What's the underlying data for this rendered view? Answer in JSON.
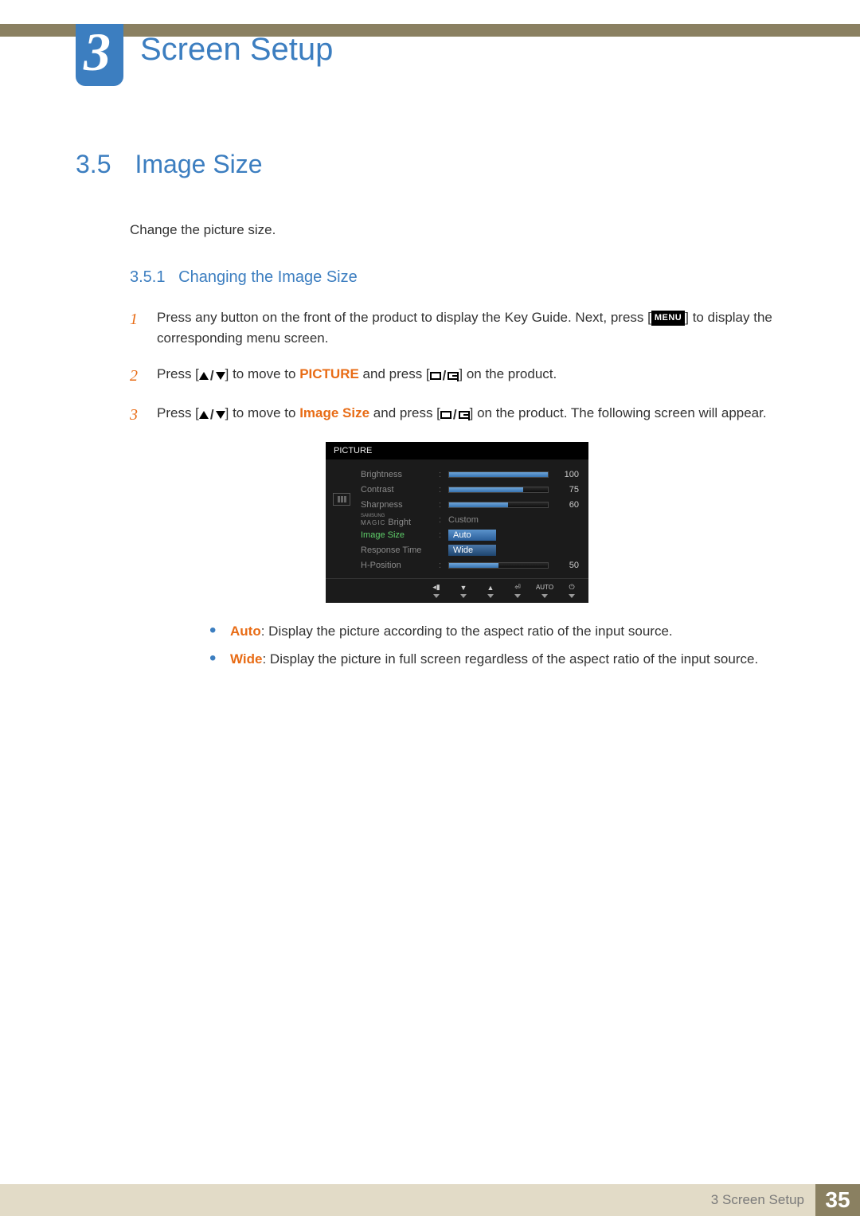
{
  "chapter": {
    "number": "3",
    "title": "Screen Setup"
  },
  "section": {
    "number": "3.5",
    "title": "Image Size",
    "intro": "Change the picture size."
  },
  "subsection": {
    "number": "3.5.1",
    "title": "Changing the Image Size"
  },
  "steps": {
    "s1": {
      "n": "1",
      "pre": "Press any button on the front of the product to display the Key Guide. Next, press [",
      "menu": "MENU",
      "post": "] to display the corresponding menu screen."
    },
    "s2": {
      "n": "2",
      "pre": "Press [",
      "mid": "] to move to ",
      "hl": "PICTURE",
      "mid2": " and press [",
      "post": "] on the product."
    },
    "s3": {
      "n": "3",
      "pre": "Press [",
      "mid": "] to move to ",
      "hl": "Image Size",
      "mid2": " and press [",
      "post": "] on the product. The following screen will appear."
    }
  },
  "osd": {
    "title": "PICTURE",
    "rows": {
      "brightness": {
        "label": "Brightness",
        "value": "100",
        "fill": 100
      },
      "contrast": {
        "label": "Contrast",
        "value": "75",
        "fill": 75
      },
      "sharpness": {
        "label": "Sharpness",
        "value": "60",
        "fill": 60
      },
      "magic": {
        "labelBrand": "SAMSUNG",
        "labelMagic": "MAGIC",
        "labelSuffix": " Bright",
        "text": "Custom"
      },
      "imagesize": {
        "label": "Image Size",
        "opt1": "Auto",
        "opt2": "Wide"
      },
      "response": {
        "label": "Response Time"
      },
      "hpos": {
        "label": "H-Position",
        "value": "50",
        "fill": 50
      }
    },
    "footer": {
      "auto": "AUTO"
    }
  },
  "bullets": {
    "b1": {
      "term": "Auto",
      "desc": ": Display the picture according to the aspect ratio of the input source."
    },
    "b2": {
      "term": "Wide",
      "desc": ": Display the picture in full screen regardless of the aspect ratio of the input source."
    }
  },
  "footer": {
    "label": "3 Screen Setup",
    "page": "35"
  }
}
